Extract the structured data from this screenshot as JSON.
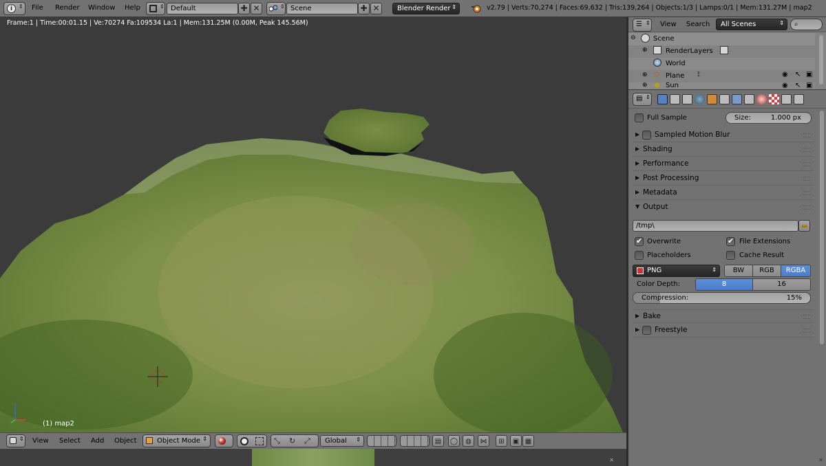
{
  "app": {
    "menus": [
      "File",
      "Render",
      "Window",
      "Help"
    ],
    "screen_layout": "Default",
    "scene_name": "Scene",
    "render_engine": "Blender Render",
    "stats": "v2.79 | Verts:70,274 | Faces:69,632 | Tris:139,264 | Objects:1/3 | Lamps:0/1 | Mem:131.27M | map2"
  },
  "viewport": {
    "info": "Frame:1 | Time:00:01.15 | Ve:70274 Fa:109534 La:1 | Mem:131.25M (0.00M, Peak 145.56M)",
    "object_label": "(1) map2",
    "header": {
      "view": "View",
      "select": "Select",
      "add": "Add",
      "object": "Object",
      "mode": "Object Mode",
      "orientation": "Global"
    }
  },
  "outliner": {
    "view": "View",
    "search": "Search",
    "filter": "All Scenes",
    "items": [
      {
        "label": "Scene",
        "icon": "scene-icon",
        "indent": 0
      },
      {
        "label": "RenderLayers",
        "icon": "renderlayers-icon",
        "indent": 1
      },
      {
        "label": "World",
        "icon": "world-icon",
        "indent": 1
      },
      {
        "label": "Plane",
        "icon": "mesh-icon",
        "indent": 1
      },
      {
        "label": "Sun",
        "icon": "lamp-icon",
        "indent": 1
      }
    ]
  },
  "properties": {
    "full_sample": "Full Sample",
    "size_label": "Size:",
    "size_value": "1.000 px",
    "panels": {
      "sampled_motion_blur": "Sampled Motion Blur",
      "shading": "Shading",
      "performance": "Performance",
      "post_processing": "Post Processing",
      "metadata": "Metadata",
      "output": "Output",
      "bake": "Bake",
      "freestyle": "Freestyle"
    },
    "output": {
      "path": "/tmp\\",
      "overwrite": "Overwrite",
      "file_extensions": "File Extensions",
      "placeholders": "Placeholders",
      "cache_result": "Cache Result",
      "format": "PNG",
      "color_modes": [
        "BW",
        "RGB",
        "RGBA"
      ],
      "active_color_mode": "RGBA",
      "color_depth_label": "Color Depth:",
      "color_depths": [
        "8",
        "16"
      ],
      "active_color_depth": "8",
      "compression_label": "Compression:",
      "compression_value": "15%"
    }
  },
  "colors": {
    "accent": "#5680c2",
    "header_bg": "#727272",
    "viewport_bg": "#3b3b3b",
    "terrain": "#6c8a3e"
  }
}
